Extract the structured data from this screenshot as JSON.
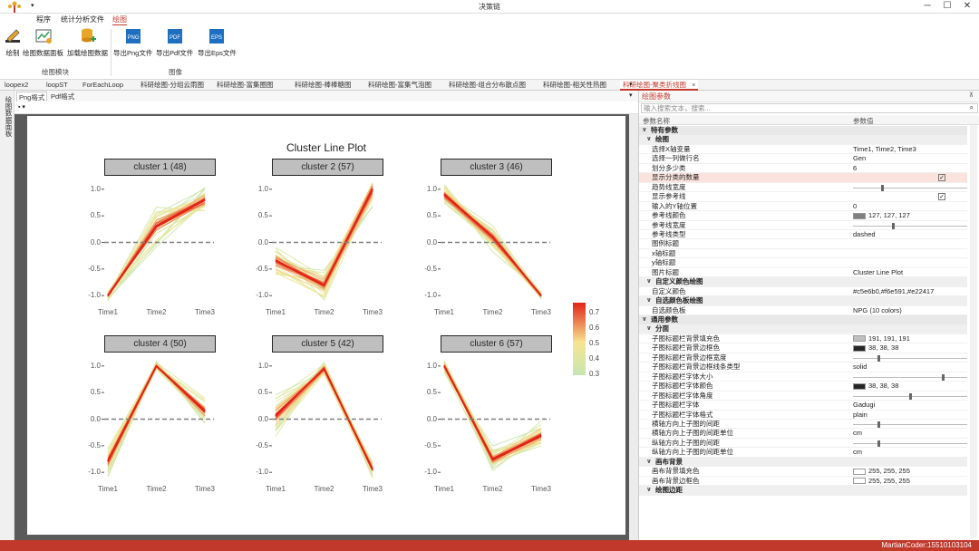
{
  "window": {
    "title": "决策链",
    "controls": [
      "─",
      "☐",
      "✕"
    ]
  },
  "menu": {
    "items": [
      "程序",
      "统计分析文件",
      "绘图"
    ],
    "active_index": 2
  },
  "ribbon": {
    "buttons": [
      {
        "label": "绘制",
        "icon": "pencil-icon"
      },
      {
        "label": "绘图数据面板",
        "icon": "data-panel-icon"
      },
      {
        "label": "加载绘图数据",
        "icon": "database-add-icon"
      },
      {
        "label": "导出Png文件",
        "icon": "png-file-icon",
        "badge": "PNG"
      },
      {
        "label": "导出Pdf文件",
        "icon": "pdf-file-icon",
        "badge": "PDF"
      },
      {
        "label": "导出Eps文件",
        "icon": "eps-file-icon",
        "badge": "EPS"
      }
    ],
    "groups": [
      "绘图模块",
      "图像"
    ],
    "icon_colors": {
      "png": "#1e6fc0",
      "pdf": "#1e6fc0",
      "eps": "#1e6fc0",
      "accent": "#e8a628"
    }
  },
  "tabs": [
    "loopex2",
    "loopST",
    "ForEachLoop",
    "科研绘图-分组云雨图",
    "科研绘图-富集圈图",
    "科研绘图-棒棒糖图",
    "科研绘图-富集气泡图",
    "科研绘图-组合分布散点图",
    "科研绘图-相关性热图",
    "科研绘图-聚类折线图"
  ],
  "active_tab_index": 9,
  "sidebar": {
    "label": "绘图数据面板"
  },
  "subtabs": {
    "items": [
      "Png格式",
      "Pdf格式"
    ],
    "active_index": 0
  },
  "chart_data": {
    "type": "line",
    "title": "Cluster Line Plot",
    "x": [
      "Time1",
      "Time2",
      "Time3"
    ],
    "yticks": [
      1.0,
      0.5,
      0.0,
      -0.5,
      -1.0
    ],
    "ytick_labels": [
      "1.0",
      "0.5",
      "0.0",
      "-0.5",
      "-1.0"
    ],
    "ylim": [
      -1.15,
      1.15
    ],
    "reference_line": {
      "y": 0,
      "color": "#7f7f7f",
      "type": "dashed"
    },
    "colors": [
      "#c5e6b0",
      "#f6e591",
      "#e22417"
    ],
    "legend": {
      "ticks": [
        "0.7",
        "0.6",
        "0.5",
        "0.4",
        "0.3"
      ],
      "placement": "right"
    },
    "strip_fill": "#bfbfbf",
    "strip_text_color": "#262626",
    "panels": [
      {
        "title": "cluster 1 (48)",
        "center": [
          -1.0,
          0.3,
          0.8
        ],
        "spread": [
          0.12,
          0.45,
          0.3
        ]
      },
      {
        "title": "cluster 2 (57)",
        "center": [
          -0.35,
          -0.8,
          1.0
        ],
        "spread": [
          0.4,
          0.35,
          0.35
        ]
      },
      {
        "title": "cluster 3 (46)",
        "center": [
          0.9,
          0.1,
          -1.0
        ],
        "spread": [
          0.25,
          0.3,
          0.1
        ]
      },
      {
        "title": "cluster 4 (50)",
        "center": [
          -0.8,
          1.0,
          0.15
        ],
        "spread": [
          0.35,
          0.1,
          0.35
        ]
      },
      {
        "title": "cluster 5 (42)",
        "center": [
          0.05,
          0.95,
          -0.95
        ],
        "spread": [
          0.45,
          0.15,
          0.2
        ]
      },
      {
        "title": "cluster 6 (57)",
        "center": [
          1.0,
          -0.75,
          -0.3
        ],
        "spread": [
          0.15,
          0.25,
          0.3
        ]
      }
    ]
  },
  "props": {
    "header": "绘图参数",
    "search_placeholder": "输入搜索文本，搜索...",
    "col_name": "参数名称",
    "col_value": "参数值",
    "rows": [
      {
        "kind": "cat",
        "name": "特有参数"
      },
      {
        "kind": "sub",
        "name": "绘图"
      },
      {
        "kind": "row",
        "name": "选择X轴变量",
        "value": "Time1, Time2, Time3"
      },
      {
        "kind": "row",
        "name": "选择一列做行名",
        "value": "Gen"
      },
      {
        "kind": "row",
        "name": "划分多少类",
        "value": "6"
      },
      {
        "kind": "check",
        "name": "显示分类的数量",
        "value": "✓",
        "highlight": true
      },
      {
        "kind": "slider",
        "name": "趋势线宽度",
        "level": 0.25
      },
      {
        "kind": "check",
        "name": "显示参考线",
        "value": "✓"
      },
      {
        "kind": "row",
        "name": "输入的Y轴位置",
        "value": "0"
      },
      {
        "kind": "color",
        "name": "参考线颜色",
        "value": "127, 127, 127",
        "swatch": "#7f7f7f"
      },
      {
        "kind": "slider",
        "name": "参考线宽度",
        "level": 0.35
      },
      {
        "kind": "row",
        "name": "参考线类型",
        "value": "dashed"
      },
      {
        "kind": "row",
        "name": "图例标题",
        "value": ""
      },
      {
        "kind": "row",
        "name": "x轴标题",
        "value": ""
      },
      {
        "kind": "row",
        "name": "y轴标题",
        "value": ""
      },
      {
        "kind": "row",
        "name": "图片标题",
        "value": "Cluster Line Plot"
      },
      {
        "kind": "sub",
        "name": "自定义颜色绘图"
      },
      {
        "kind": "row",
        "name": "自定义颜色",
        "value": "#c5e6b0,#f6e591,#e22417"
      },
      {
        "kind": "sub",
        "name": "自选颜色板绘图"
      },
      {
        "kind": "row",
        "name": "自选颜色板",
        "value": "NPG (10 colors)"
      },
      {
        "kind": "cat",
        "name": "通用参数"
      },
      {
        "kind": "sub",
        "name": "分面"
      },
      {
        "kind": "color",
        "name": "子图标题栏背景填充色",
        "value": "191, 191, 191",
        "swatch": "#bfbfbf"
      },
      {
        "kind": "color",
        "name": "子图标题栏背景边框色",
        "value": "38, 38, 38",
        "swatch": "#262626"
      },
      {
        "kind": "slider",
        "name": "子图标题栏背景边框宽度",
        "level": 0.22
      },
      {
        "kind": "row",
        "name": "子图标题栏背景边框线条类型",
        "value": "solid"
      },
      {
        "kind": "slider",
        "name": "子图标题栏字体大小",
        "level": 0.8
      },
      {
        "kind": "color",
        "name": "子图标题栏字体颜色",
        "value": "38, 38, 38",
        "swatch": "#262626"
      },
      {
        "kind": "slider",
        "name": "子图标题栏字体角度",
        "level": 0.5
      },
      {
        "kind": "row",
        "name": "子图标题栏字体",
        "value": "Gadugi"
      },
      {
        "kind": "row",
        "name": "子图标题栏字体格式",
        "value": "plain"
      },
      {
        "kind": "slider",
        "name": "横轴方向上子图的间距",
        "level": 0.22
      },
      {
        "kind": "row",
        "name": "横轴方向上子图的间距单位",
        "value": "cm"
      },
      {
        "kind": "slider",
        "name": "纵轴方向上子图的间距",
        "level": 0.22
      },
      {
        "kind": "row",
        "name": "纵轴方向上子图的间距单位",
        "value": "cm"
      },
      {
        "kind": "sub",
        "name": "画布背景"
      },
      {
        "kind": "color",
        "name": "画布背景填充色",
        "value": "255, 255, 255",
        "swatch": "#ffffff"
      },
      {
        "kind": "color",
        "name": "画布背景边框色",
        "value": "255, 255, 255",
        "swatch": "#ffffff"
      },
      {
        "kind": "sub",
        "name": "绘图边距"
      }
    ]
  },
  "status": {
    "text": "MartianCoder:15510103104"
  }
}
